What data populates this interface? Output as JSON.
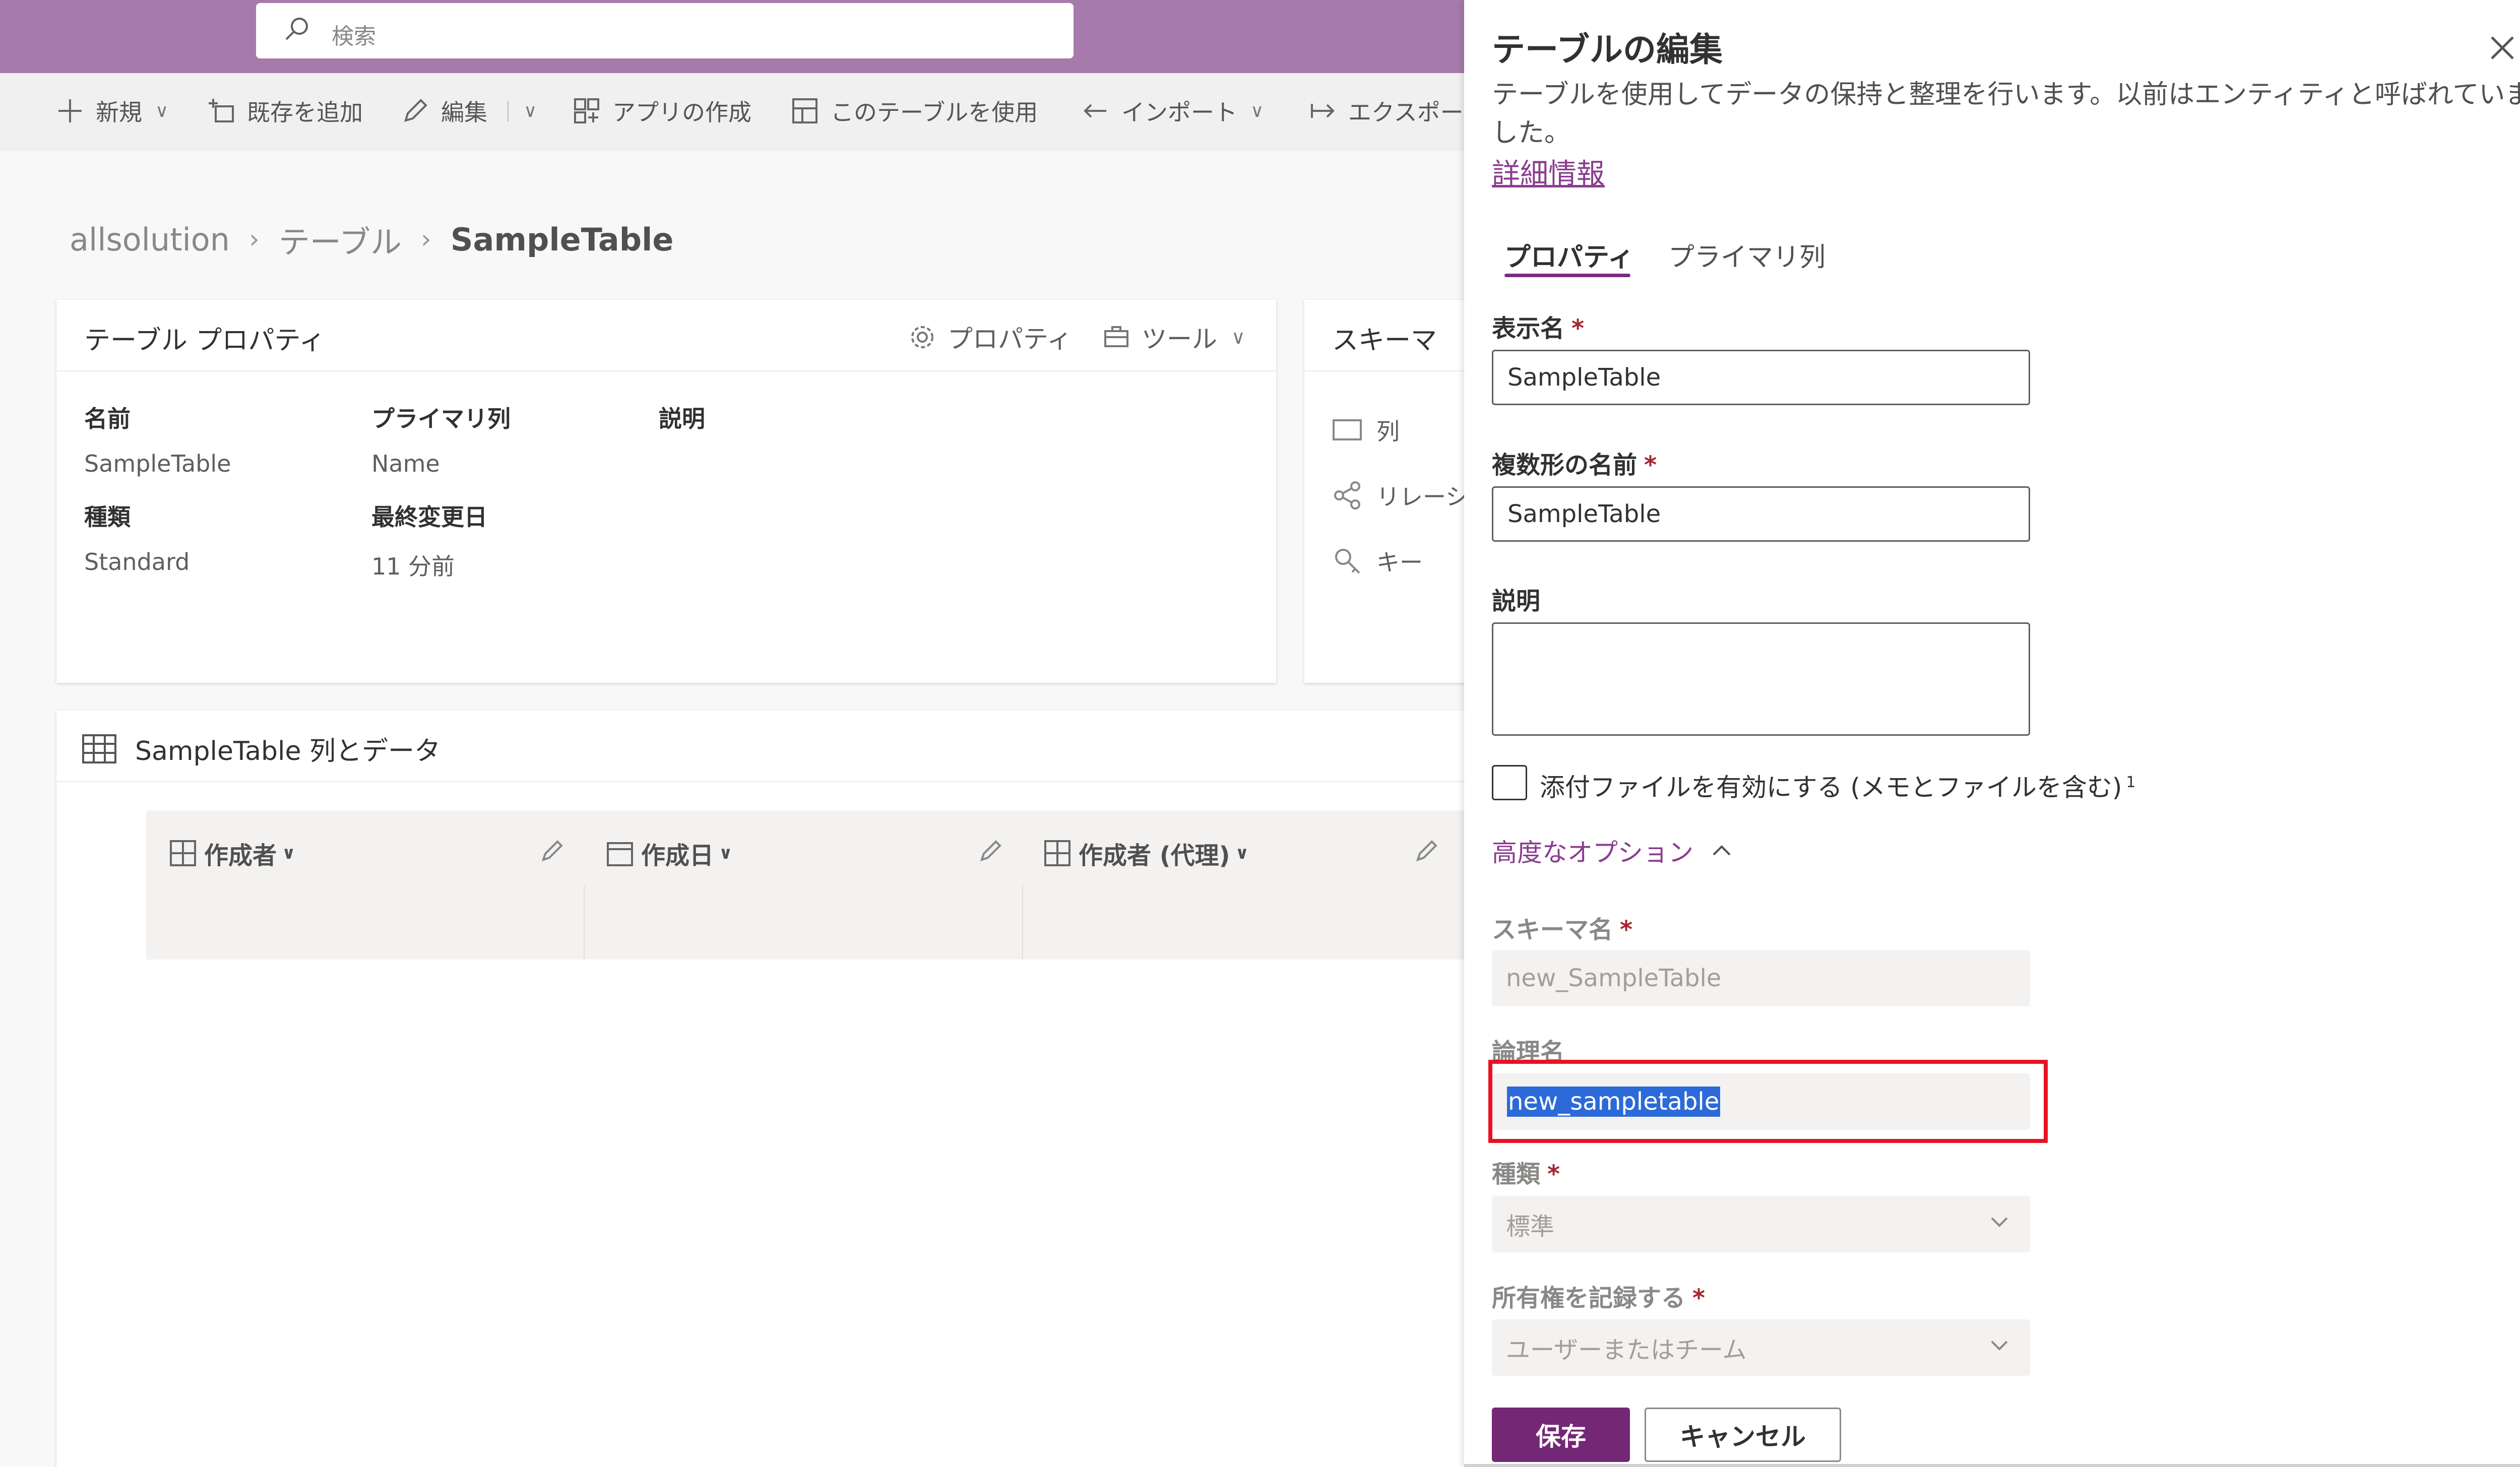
{
  "search": {
    "placeholder": "検索"
  },
  "commands": [
    {
      "label": "新規"
    },
    {
      "label": "既存を追加"
    },
    {
      "label": "編集"
    },
    {
      "label": "アプリの作成"
    },
    {
      "label": "このテーブルを使用"
    },
    {
      "label": "インポート"
    },
    {
      "label": "エクスポー"
    }
  ],
  "breadcrumb": {
    "root": "allsolution",
    "section": "テーブル",
    "current": "SampleTable"
  },
  "table_properties_card": {
    "title": "テーブル プロパティ",
    "properties_button": "プロパティ",
    "tools_button": "ツール",
    "labels": {
      "name": "名前",
      "primary_column": "プライマリ列",
      "description": "説明",
      "type": "種類",
      "last_modified": "最終変更日"
    },
    "values": {
      "name": "SampleTable",
      "primary_column": "Name",
      "type": "Standard",
      "last_modified": "11 分前"
    }
  },
  "schema_card": {
    "title": "スキーマ",
    "items": [
      "列",
      "リレーシ",
      "キー"
    ]
  },
  "data_card": {
    "title": "SampleTable 列とデータ",
    "columns": [
      {
        "label": "作成者"
      },
      {
        "label": "作成日"
      },
      {
        "label": "作成者 (代理)"
      }
    ]
  },
  "panel": {
    "title": "テーブルの編集",
    "description": "テーブルを使用してデータの保持と整理を行います。以前はエンティティと呼ばれていました。",
    "learn_more": "詳細情報",
    "tabs": [
      "プロパティ",
      "プライマリ列"
    ],
    "display_name": {
      "label": "表示名",
      "value": "SampleTable"
    },
    "plural_name": {
      "label": "複数形の名前",
      "value": "SampleTable"
    },
    "description_field": {
      "label": "説明",
      "value": ""
    },
    "attachments": {
      "label": "添付ファイルを有効にする (メモとファイルを含む)",
      "footnote": "1",
      "checked": false
    },
    "advanced_toggle": "高度なオプション",
    "schema_name": {
      "label": "スキーマ名",
      "value": "new_SampleTable"
    },
    "logical_name": {
      "label": "論理名",
      "value": "new_sampletable"
    },
    "type": {
      "label": "種類",
      "value": "標準"
    },
    "ownership": {
      "label": "所有権を記録する",
      "value": "ユーザーまたはチーム"
    },
    "required_marker": "*",
    "save": "保存",
    "cancel": "キャンセル"
  },
  "colors": {
    "header": "#a67aab",
    "accent": "#742774",
    "link": "#8a3d8e",
    "highlight": "#e81224",
    "selection": "#2b6ad8"
  }
}
